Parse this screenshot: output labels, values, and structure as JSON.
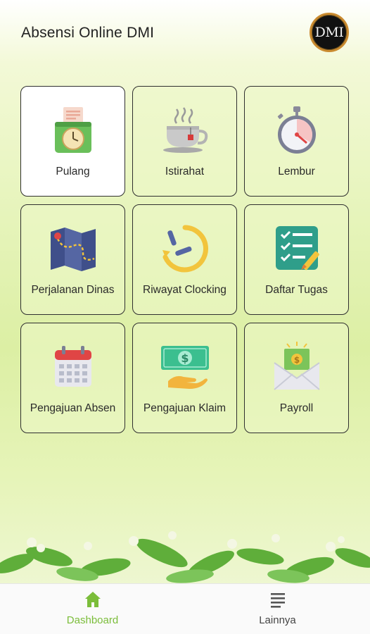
{
  "header": {
    "title": "Absensi Online DMI",
    "logo_text": "DMI"
  },
  "menu": {
    "items": [
      {
        "label": "Pulang",
        "icon": "time-clock-icon",
        "selected": true
      },
      {
        "label": "Istirahat",
        "icon": "coffee-cup-icon",
        "selected": false
      },
      {
        "label": "Lembur",
        "icon": "stopwatch-icon",
        "selected": false
      },
      {
        "label": "Perjalanan Dinas",
        "icon": "map-icon",
        "selected": false
      },
      {
        "label": "Riwayat Clocking",
        "icon": "history-clock-icon",
        "selected": false
      },
      {
        "label": "Daftar Tugas",
        "icon": "checklist-icon",
        "selected": false
      },
      {
        "label": "Pengajuan Absen",
        "icon": "calendar-icon",
        "selected": false
      },
      {
        "label": "Pengajuan Klaim",
        "icon": "money-hand-icon",
        "selected": false
      },
      {
        "label": "Payroll",
        "icon": "money-envelope-icon",
        "selected": false
      }
    ]
  },
  "bottom_nav": {
    "dashboard": {
      "label": "Dashboard",
      "icon": "home-icon",
      "active": true
    },
    "lainnya": {
      "label": "Lainnya",
      "icon": "menu-lines-icon",
      "active": false
    }
  },
  "colors": {
    "accent": "#7bbd3a",
    "tile_border": "#2f2f2f",
    "avatar_ring": "#c98a2f"
  }
}
